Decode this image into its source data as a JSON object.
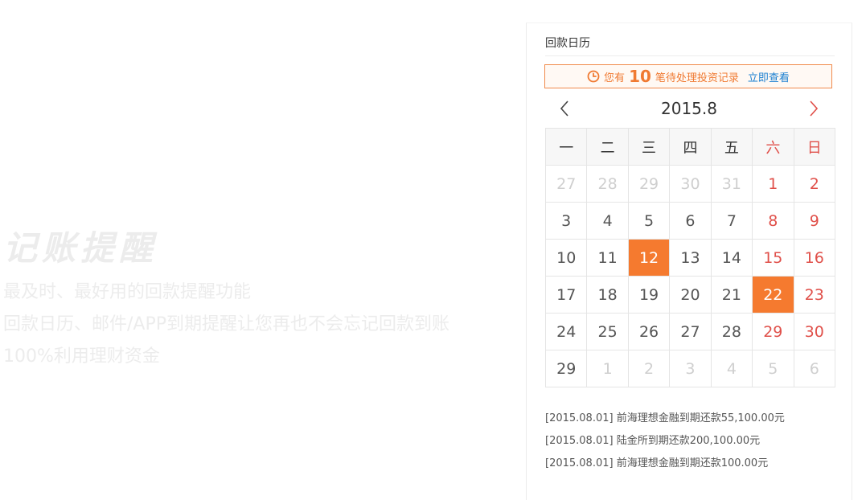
{
  "promo": {
    "title": "记账提醒",
    "lines": [
      "最及时、最好用的回款提醒功能",
      "回款日历、邮件/APP到期提醒让您再也不会忘记回款到账",
      "100%利用理财资金"
    ]
  },
  "panel": {
    "title": "回款日历",
    "notice": {
      "prefix": "您有",
      "count": "10",
      "suffix": "笔待处理投资记录",
      "link": "立即查看",
      "icon": "clock-icon"
    },
    "month": "2015.8",
    "weekdays": [
      "一",
      "二",
      "三",
      "四",
      "五",
      "六",
      "日"
    ],
    "weeks": [
      [
        {
          "d": "27",
          "t": "other"
        },
        {
          "d": "28",
          "t": "other"
        },
        {
          "d": "29",
          "t": "other"
        },
        {
          "d": "30",
          "t": "other"
        },
        {
          "d": "31",
          "t": "other"
        },
        {
          "d": "1",
          "t": "wkend"
        },
        {
          "d": "2",
          "t": "wkend"
        }
      ],
      [
        {
          "d": "3",
          "t": ""
        },
        {
          "d": "4",
          "t": ""
        },
        {
          "d": "5",
          "t": ""
        },
        {
          "d": "6",
          "t": ""
        },
        {
          "d": "7",
          "t": ""
        },
        {
          "d": "8",
          "t": "wkend"
        },
        {
          "d": "9",
          "t": "wkend"
        }
      ],
      [
        {
          "d": "10",
          "t": ""
        },
        {
          "d": "11",
          "t": ""
        },
        {
          "d": "12",
          "t": "hl"
        },
        {
          "d": "13",
          "t": ""
        },
        {
          "d": "14",
          "t": ""
        },
        {
          "d": "15",
          "t": "wkend"
        },
        {
          "d": "16",
          "t": "wkend"
        }
      ],
      [
        {
          "d": "17",
          "t": ""
        },
        {
          "d": "18",
          "t": ""
        },
        {
          "d": "19",
          "t": ""
        },
        {
          "d": "20",
          "t": ""
        },
        {
          "d": "21",
          "t": ""
        },
        {
          "d": "22",
          "t": "hl"
        },
        {
          "d": "23",
          "t": "wkend"
        }
      ],
      [
        {
          "d": "24",
          "t": ""
        },
        {
          "d": "25",
          "t": ""
        },
        {
          "d": "26",
          "t": ""
        },
        {
          "d": "27",
          "t": ""
        },
        {
          "d": "28",
          "t": ""
        },
        {
          "d": "29",
          "t": "wkend"
        },
        {
          "d": "30",
          "t": "wkend"
        }
      ],
      [
        {
          "d": "29",
          "t": ""
        },
        {
          "d": "1",
          "t": "other"
        },
        {
          "d": "2",
          "t": "other"
        },
        {
          "d": "3",
          "t": "other"
        },
        {
          "d": "4",
          "t": "other"
        },
        {
          "d": "5",
          "t": "other"
        },
        {
          "d": "6",
          "t": "other"
        }
      ]
    ],
    "records": [
      "[2015.08.01] 前海理想金融到期还款55,100.00元",
      "[2015.08.01] 陆金所到期还款200,100.00元",
      "[2015.08.01] 前海理想金融到期还款100.00元"
    ]
  },
  "colors": {
    "accent": "#f57a2f",
    "weekend": "#e0504a",
    "link": "#1a7fd1"
  }
}
